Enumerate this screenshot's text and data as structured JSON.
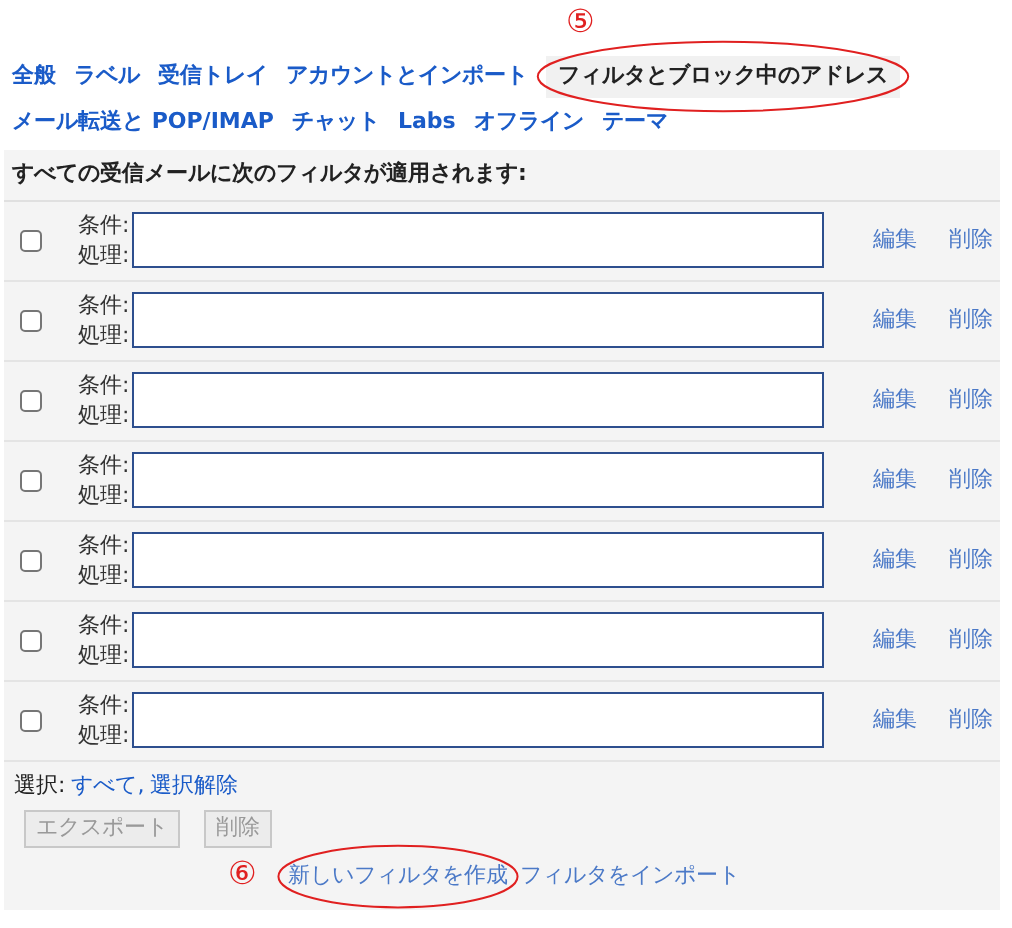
{
  "tab_rows": [
    [
      {
        "label": "全般",
        "selected": false
      },
      {
        "label": "ラベル",
        "selected": false
      },
      {
        "label": "受信トレイ",
        "selected": false
      },
      {
        "label": "アカウントとインポート",
        "selected": false
      },
      {
        "label": "フィルタとブロック中のアドレス",
        "selected": true,
        "annotation": "⑤"
      }
    ],
    [
      {
        "label": "メール転送と POP/IMAP",
        "selected": false
      },
      {
        "label": "チャット",
        "selected": false
      },
      {
        "label": "Labs",
        "selected": false
      },
      {
        "label": "オフライン",
        "selected": false
      },
      {
        "label": "テーマ",
        "selected": false
      }
    ]
  ],
  "heading": "すべての受信メールに次のフィルタが適用されます:",
  "filters": [
    {
      "checked": false,
      "condition_label": "条件:",
      "action_label": "処理:",
      "edit": "編集",
      "delete": "削除"
    },
    {
      "checked": false,
      "condition_label": "条件:",
      "action_label": "処理:",
      "edit": "編集",
      "delete": "削除"
    },
    {
      "checked": false,
      "condition_label": "条件:",
      "action_label": "処理:",
      "edit": "編集",
      "delete": "削除"
    },
    {
      "checked": false,
      "condition_label": "条件:",
      "action_label": "処理:",
      "edit": "編集",
      "delete": "削除"
    },
    {
      "checked": false,
      "condition_label": "条件:",
      "action_label": "処理:",
      "edit": "編集",
      "delete": "削除"
    },
    {
      "checked": false,
      "condition_label": "条件:",
      "action_label": "処理:",
      "edit": "編集",
      "delete": "削除"
    },
    {
      "checked": false,
      "condition_label": "条件:",
      "action_label": "処理:",
      "edit": "編集",
      "delete": "削除"
    }
  ],
  "select": {
    "label": "選択:",
    "all": "すべて,",
    "none": "選択解除"
  },
  "buttons": [
    {
      "label": "エクスポート",
      "disabled": true
    },
    {
      "label": "削除",
      "disabled": true
    }
  ],
  "links": [
    {
      "label": "新しいフィルタを作成",
      "annotation": "⑥"
    },
    {
      "label": "フィルタをインポート"
    }
  ]
}
